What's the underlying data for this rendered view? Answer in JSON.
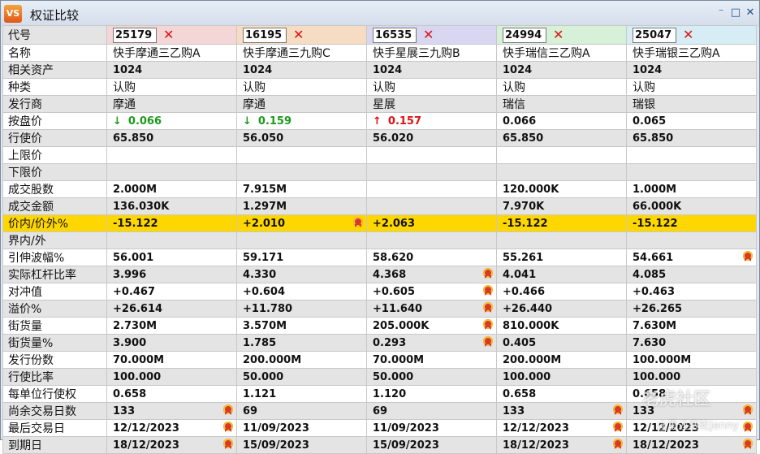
{
  "window": {
    "icon_text": "VS",
    "title": "权证比较",
    "controls": [
      "⁻",
      "□",
      "✕"
    ]
  },
  "header_colors": [
    "#f4d6d6",
    "#f6dcc3",
    "#d9d6f2",
    "#d6f1d8",
    "#d6edf6"
  ],
  "rows": {
    "code": "代号",
    "name": "名称",
    "underlying": "相关资产",
    "type": "种类",
    "issuer": "发行商",
    "bid": "按盘价",
    "strike": "行使价",
    "upper": "上限价",
    "lower": "下限价",
    "volume": "成交股数",
    "turnover": "成交金额",
    "moneyness": "价内/价外%",
    "range": "界内/外",
    "iv": "引伸波幅%",
    "gearing": "实际杠杆比率",
    "delta": "对冲值",
    "premium": "溢价%",
    "outstanding": "街货量",
    "outstanding_pct": "街货量%",
    "issue_size": "发行份数",
    "ratio": "行使比率",
    "per_unit": "每单位行使权",
    "days_left": "尚余交易日数",
    "last_trade": "最后交易日",
    "expiry": "到期日"
  },
  "warrants": [
    {
      "code": "25179",
      "name": "快手摩通三乙购A",
      "underlying": "1024",
      "type": "认购",
      "issuer": "摩通",
      "bid": "0.066",
      "bid_dir": "down",
      "strike": "65.850",
      "upper": "",
      "lower": "",
      "volume": "2.000M",
      "turnover": "136.030K",
      "moneyness": "-15.122",
      "range": "",
      "iv": "56.001",
      "gearing": "3.996",
      "delta": "+0.467",
      "premium": "+26.614",
      "outstanding": "2.730M",
      "outstanding_pct": "3.900",
      "issue_size": "70.000M",
      "ratio": "100.000",
      "per_unit": "0.658",
      "days_left": "133",
      "last_trade": "12/12/2023",
      "expiry": "18/12/2023",
      "badges": [
        "days_left",
        "last_trade",
        "expiry"
      ]
    },
    {
      "code": "16195",
      "name": "快手摩通三九购C",
      "underlying": "1024",
      "type": "认购",
      "issuer": "摩通",
      "bid": "0.159",
      "bid_dir": "down",
      "strike": "56.050",
      "upper": "",
      "lower": "",
      "volume": "7.915M",
      "turnover": "1.297M",
      "moneyness": "+2.010",
      "range": "",
      "iv": "59.171",
      "gearing": "4.330",
      "delta": "+0.604",
      "premium": "+11.780",
      "outstanding": "3.570M",
      "outstanding_pct": "1.785",
      "issue_size": "200.000M",
      "ratio": "50.000",
      "per_unit": "1.121",
      "days_left": "69",
      "last_trade": "11/09/2023",
      "expiry": "15/09/2023",
      "badges": [
        "moneyness"
      ]
    },
    {
      "code": "16535",
      "name": "快手星展三九购B",
      "underlying": "1024",
      "type": "认购",
      "issuer": "星展",
      "bid": "0.157",
      "bid_dir": "up",
      "strike": "56.020",
      "upper": "",
      "lower": "",
      "volume": "",
      "turnover": "",
      "moneyness": "+2.063",
      "range": "",
      "iv": "58.620",
      "gearing": "4.368",
      "delta": "+0.605",
      "premium": "+11.640",
      "outstanding": "205.000K",
      "outstanding_pct": "0.293",
      "issue_size": "70.000M",
      "ratio": "50.000",
      "per_unit": "1.120",
      "days_left": "69",
      "last_trade": "11/09/2023",
      "expiry": "15/09/2023",
      "badges": [
        "gearing",
        "delta",
        "premium",
        "outstanding",
        "outstanding_pct"
      ]
    },
    {
      "code": "24994",
      "name": "快手瑞信三乙购A",
      "underlying": "1024",
      "type": "认购",
      "issuer": "瑞信",
      "bid": "0.066",
      "bid_dir": "",
      "strike": "65.850",
      "upper": "",
      "lower": "",
      "volume": "120.000K",
      "turnover": "7.970K",
      "moneyness": "-15.122",
      "range": "",
      "iv": "55.261",
      "gearing": "4.041",
      "delta": "+0.466",
      "premium": "+26.440",
      "outstanding": "810.000K",
      "outstanding_pct": "0.405",
      "issue_size": "200.000M",
      "ratio": "100.000",
      "per_unit": "0.658",
      "days_left": "133",
      "last_trade": "12/12/2023",
      "expiry": "18/12/2023",
      "badges": [
        "days_left",
        "last_trade",
        "expiry"
      ]
    },
    {
      "code": "25047",
      "name": "快手瑞银三乙购A",
      "underlying": "1024",
      "type": "认购",
      "issuer": "瑞银",
      "bid": "0.065",
      "bid_dir": "",
      "strike": "65.850",
      "upper": "",
      "lower": "",
      "volume": "1.000M",
      "turnover": "66.000K",
      "moneyness": "-15.122",
      "range": "",
      "iv": "54.661",
      "gearing": "4.085",
      "delta": "+0.463",
      "premium": "+26.265",
      "outstanding": "7.630M",
      "outstanding_pct": "7.630",
      "issue_size": "100.000M",
      "ratio": "100.000",
      "per_unit": "0.658",
      "days_left": "133",
      "last_trade": "12/12/2023",
      "expiry": "18/12/2023",
      "badges": [
        "iv",
        "days_left",
        "last_trade",
        "expiry"
      ]
    }
  ],
  "watermark": {
    "line1": "老虎社区",
    "line2": "@重返赛轮Jenny"
  }
}
